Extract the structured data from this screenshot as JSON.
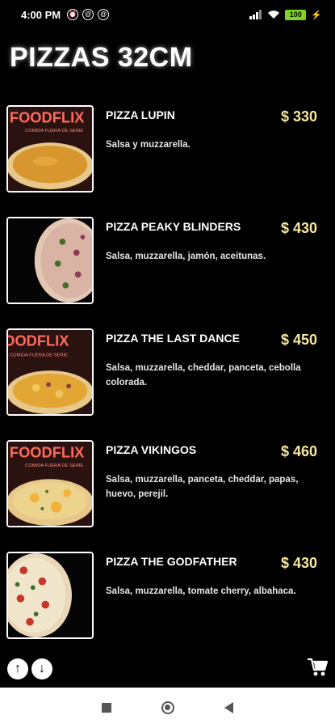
{
  "status": {
    "time": "4:00 PM",
    "battery": "100"
  },
  "page": {
    "title": "PIZZAS 32CM"
  },
  "brand": {
    "logo": "FOODFLIX",
    "tagline": "COMIDA FUERA DE SERIE"
  },
  "items": [
    {
      "name": "PIZZA LUPIN",
      "price": "$ 330",
      "description": "Salsa y muzzarella."
    },
    {
      "name": "PIZZA PEAKY BLINDERS",
      "price": "$ 430",
      "description": "Salsa, muzzarella, jamón, aceitunas."
    },
    {
      "name": "PIZZA THE LAST DANCE",
      "price": "$ 450",
      "description": "Salsa, muzzarella, cheddar, panceta, cebolla colorada."
    },
    {
      "name": "PIZZA VIKINGOS",
      "price": "$ 460",
      "description": "Salsa, muzzarella, panceta, cheddar, papas, huevo, perejil."
    },
    {
      "name": "PIZZA THE GODFATHER",
      "price": "$ 430",
      "description": "Salsa, muzzarella, tomate cherry, albahaca."
    }
  ],
  "colors": {
    "background": "#000000",
    "price": "#f7e99a",
    "text": "#ffffff"
  },
  "icons": {
    "scroll_up": "arrow-up-icon",
    "scroll_down": "arrow-down-icon",
    "cart": "cart-icon"
  }
}
